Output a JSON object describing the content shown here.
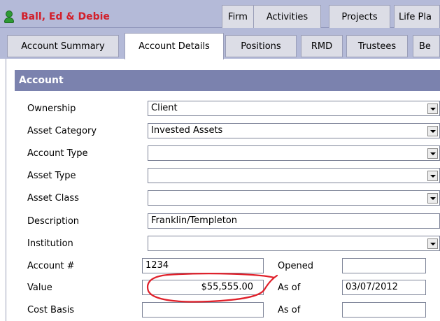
{
  "header": {
    "client_name": "Ball, Ed & Debie",
    "tabs": [
      "Firm",
      "Activities",
      "Projects",
      "Life Pla"
    ]
  },
  "subtabs": [
    "Account Summary",
    "Account Details",
    "Positions",
    "RMD",
    "Trustees",
    "Be"
  ],
  "active_subtab": "Account Details",
  "section": {
    "title": "Account"
  },
  "form": {
    "ownership": {
      "label": "Ownership",
      "value": "Client"
    },
    "asset_category": {
      "label": "Asset Category",
      "value": "Invested Assets"
    },
    "account_type": {
      "label": "Account Type",
      "value": ""
    },
    "asset_type": {
      "label": "Asset Type",
      "value": ""
    },
    "asset_class": {
      "label": "Asset Class",
      "value": ""
    },
    "description": {
      "label": "Description",
      "value": "Franklin/Templeton"
    },
    "institution": {
      "label": "Institution",
      "value": ""
    },
    "account_number": {
      "label": "Account #",
      "value": "1234"
    },
    "opened": {
      "label": "Opened",
      "value": ""
    },
    "value": {
      "label": "Value",
      "value": "$55,555.00"
    },
    "value_as_of": {
      "label": "As of",
      "value": "03/07/2012"
    },
    "cost_basis": {
      "label": "Cost Basis",
      "value": ""
    },
    "cost_basis_as_of": {
      "label": "As of",
      "value": ""
    }
  },
  "colors": {
    "header_bg": "#b4bad8",
    "section_header": "#7b82ae",
    "client_name": "#d21f2a",
    "annotation": "#e0202a"
  },
  "icons": {
    "client": "person-icon",
    "dropdown": "chevron-down-icon"
  }
}
